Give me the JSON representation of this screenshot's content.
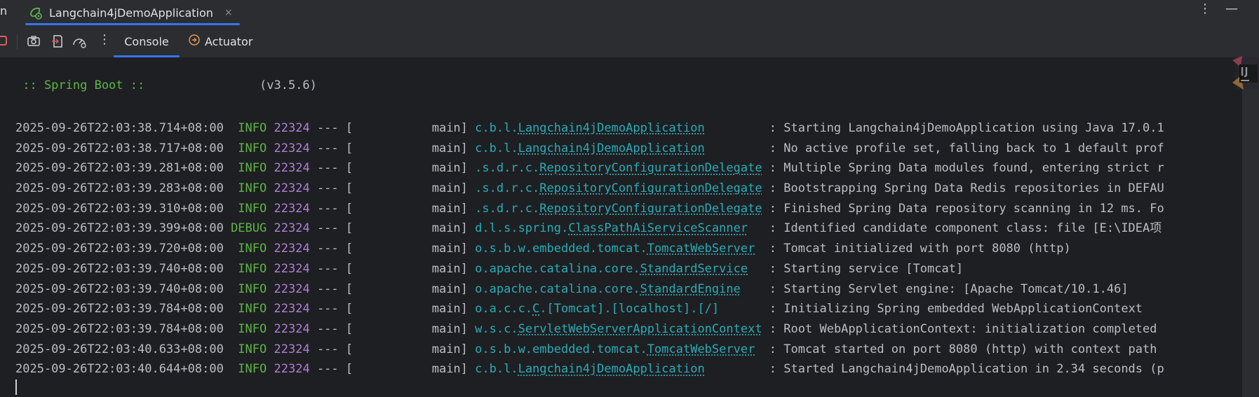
{
  "window": {
    "edge_glyph": "n",
    "tab": {
      "label": "Langchain4jDemoApplication",
      "close": "×"
    },
    "actions": {
      "more": "⋮",
      "minimize": "—"
    }
  },
  "toolbar": {
    "more": "⋮",
    "tabs": [
      {
        "label": "Console",
        "active": true
      },
      {
        "label": "Actuator",
        "active": false
      }
    ]
  },
  "console": {
    "banner": {
      "label": " :: Spring Boot :: ",
      "version": "(v3.5.6)"
    },
    "logs": [
      {
        "ts": "2025-09-26T22:03:38.714+08:00",
        "level": "INFO",
        "pid": "22324",
        "sep": "---",
        "thread": "[           main]",
        "logger_prefix": "c.b.l.",
        "logger_class": "Langchain4jDemoApplication",
        "message": "Starting Langchain4jDemoApplication using Java 17.0.1"
      },
      {
        "ts": "2025-09-26T22:03:38.717+08:00",
        "level": "INFO",
        "pid": "22324",
        "sep": "---",
        "thread": "[           main]",
        "logger_prefix": "c.b.l.",
        "logger_class": "Langchain4jDemoApplication",
        "message": "No active profile set, falling back to 1 default prof"
      },
      {
        "ts": "2025-09-26T22:03:39.281+08:00",
        "level": "INFO",
        "pid": "22324",
        "sep": "---",
        "thread": "[           main]",
        "logger_prefix": ".s.d.r.c.",
        "logger_class": "RepositoryConfigurationDelegate",
        "message": "Multiple Spring Data modules found, entering strict r"
      },
      {
        "ts": "2025-09-26T22:03:39.283+08:00",
        "level": "INFO",
        "pid": "22324",
        "sep": "---",
        "thread": "[           main]",
        "logger_prefix": ".s.d.r.c.",
        "logger_class": "RepositoryConfigurationDelegate",
        "message": "Bootstrapping Spring Data Redis repositories in DEFAU"
      },
      {
        "ts": "2025-09-26T22:03:39.310+08:00",
        "level": "INFO",
        "pid": "22324",
        "sep": "---",
        "thread": "[           main]",
        "logger_prefix": ".s.d.r.c.",
        "logger_class": "RepositoryConfigurationDelegate",
        "message": "Finished Spring Data repository scanning in 12 ms. Fo"
      },
      {
        "ts": "2025-09-26T22:03:39.399+08:00",
        "level": "DEBUG",
        "pid": "22324",
        "sep": "---",
        "thread": "[           main]",
        "logger_prefix": "d.l.s.spring.",
        "logger_class": "ClassPathAiServiceScanner",
        "message": "Identified candidate component class: file [E:\\IDEA项"
      },
      {
        "ts": "2025-09-26T22:03:39.720+08:00",
        "level": "INFO",
        "pid": "22324",
        "sep": "---",
        "thread": "[           main]",
        "logger_prefix": "o.s.b.w.embedded.tomcat.",
        "logger_class": "TomcatWebServer",
        "message": "Tomcat initialized with port 8080 (http)"
      },
      {
        "ts": "2025-09-26T22:03:39.740+08:00",
        "level": "INFO",
        "pid": "22324",
        "sep": "---",
        "thread": "[           main]",
        "logger_prefix": "o.apache.catalina.core.",
        "logger_class": "StandardService",
        "message": "Starting service [Tomcat]"
      },
      {
        "ts": "2025-09-26T22:03:39.740+08:00",
        "level": "INFO",
        "pid": "22324",
        "sep": "---",
        "thread": "[           main]",
        "logger_prefix": "o.apache.catalina.core.",
        "logger_class": "StandardEngine",
        "message": "Starting Servlet engine: [Apache Tomcat/10.1.46]"
      },
      {
        "ts": "2025-09-26T22:03:39.784+08:00",
        "level": "INFO",
        "pid": "22324",
        "sep": "---",
        "thread": "[           main]",
        "logger_prefix": "o.a.c.c.",
        "logger_class": "C",
        "logger_suffix": ".[Tomcat].[localhost].[/]",
        "message": "Initializing Spring embedded WebApplicationContext"
      },
      {
        "ts": "2025-09-26T22:03:39.784+08:00",
        "level": "INFO",
        "pid": "22324",
        "sep": "---",
        "thread": "[           main]",
        "logger_prefix": "w.s.c.",
        "logger_class": "ServletWebServerApplicationContext",
        "message": "Root WebApplicationContext: initialization completed"
      },
      {
        "ts": "2025-09-26T22:03:40.633+08:00",
        "level": "INFO",
        "pid": "22324",
        "sep": "---",
        "thread": "[           main]",
        "logger_prefix": "o.s.b.w.embedded.tomcat.",
        "logger_class": "TomcatWebServer",
        "message": "Tomcat started on port 8080 (http) with context path"
      },
      {
        "ts": "2025-09-26T22:03:40.644+08:00",
        "level": "INFO",
        "pid": "22324",
        "sep": "---",
        "thread": "[           main]",
        "logger_prefix": "c.b.l.",
        "logger_class": "Langchain4jDemoApplication",
        "message": "Started Langchain4jDemoApplication in 2.34 seconds (p"
      }
    ]
  },
  "colors": {
    "accent": "#3574f0",
    "info": "#5fb447",
    "pid": "#b07fd6",
    "logger": "#2aacb8",
    "text": "#bcbec4",
    "stop": "#db5c5c"
  }
}
